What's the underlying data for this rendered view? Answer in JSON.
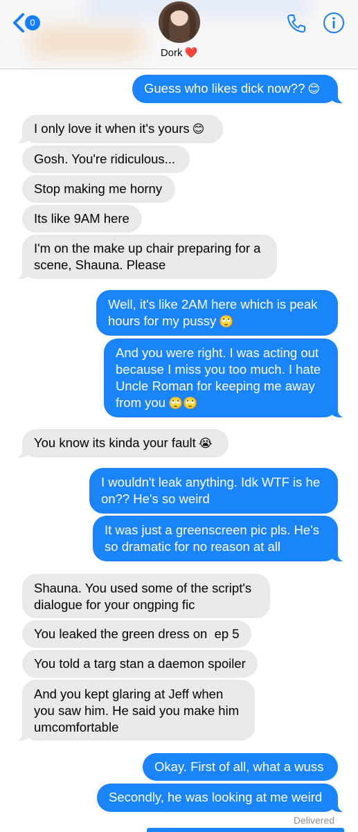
{
  "header": {
    "back_badge": "0",
    "contact_name": "Dork",
    "contact_heart": "❤️",
    "icons": {
      "back": "chevron-left-icon",
      "phone": "phone-icon",
      "info": "info-icon"
    }
  },
  "colors": {
    "outgoing": "#1a84fb",
    "incoming": "#e9e9eb",
    "accent": "#157efb",
    "heart": "#e0242f"
  },
  "messages": [
    {
      "dir": "out",
      "text": "Guess who likes dick now??",
      "emoji": "😊"
    },
    {
      "dir": "in",
      "text": "I only love it when it's yours",
      "emoji": "😊"
    },
    {
      "dir": "in",
      "text": "Gosh. You're ridiculous...",
      "emoji": ""
    },
    {
      "dir": "in",
      "text": "Stop making me horny",
      "emoji": ""
    },
    {
      "dir": "in",
      "text": "Its like 9AM here",
      "emoji": ""
    },
    {
      "dir": "in",
      "text": "I'm on the make up chair preparing for a scene, Shauna. Please",
      "emoji": ""
    },
    {
      "dir": "out",
      "text": "Well, it's like 2AM here which is peak hours for my pussy",
      "emoji": "🙄"
    },
    {
      "dir": "out",
      "text": "And you were right. I was acting out because I miss you too much. I hate Uncle Roman for keeping me away from you",
      "emoji": "🙄🙄"
    },
    {
      "dir": "in",
      "text": "You know its kinda your fault",
      "emoji": "😭"
    },
    {
      "dir": "out",
      "text": "I wouldn't leak anything. Idk WTF is he on?? He's so weird",
      "emoji": ""
    },
    {
      "dir": "out",
      "text": "It was just a greenscreen pic pls. He's so dramatic for no reason at all",
      "emoji": ""
    },
    {
      "dir": "in",
      "text": "Shauna. You used some of the script's dialogue for your ongping fic",
      "emoji": ""
    },
    {
      "dir": "in",
      "text": "You leaked the green dress on  ep 5",
      "emoji": ""
    },
    {
      "dir": "in",
      "text": "You told a targ stan a daemon spoiler",
      "emoji": ""
    },
    {
      "dir": "in",
      "text": "And you kept glaring at Jeff when you saw him. He said you make him umcomfortable",
      "emoji": ""
    },
    {
      "dir": "out",
      "text": "Okay. First of all, what a wuss",
      "emoji": ""
    },
    {
      "dir": "out",
      "text": "Secondly, he was looking at me weird",
      "emoji": ""
    }
  ],
  "status": {
    "delivered": "Delivered"
  }
}
